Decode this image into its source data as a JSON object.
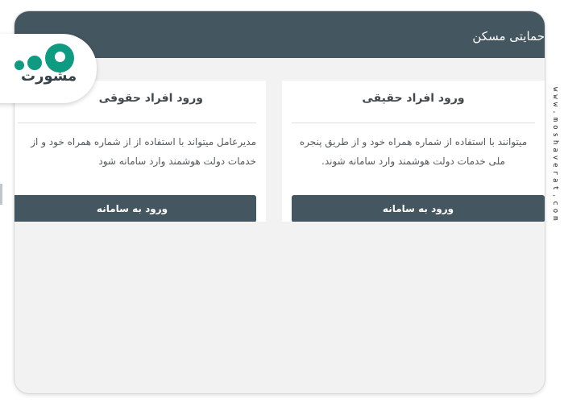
{
  "header": {
    "title": "حمایتی مسکن"
  },
  "cards": [
    {
      "title": "ورود افراد حقیقی",
      "description": "میتوانند با استفاده از شماره همراه خود و از طریق پنجره ملی خدمات دولت هوشمند وارد سامانه شوند.",
      "button_label": "ورود به سامانه"
    },
    {
      "title": "ورود افراد حقوقی",
      "description": "مدیرعامل میتواند با استفاده از از شماره همراه خود و از خدمات دولت هوشمند وارد سامانه شود",
      "button_label": "ورود به سامانه"
    }
  ],
  "logo": {
    "text": "مشورت"
  },
  "watermark": "www.moshaverat.com",
  "colors": {
    "header": "#44565f",
    "button": "#44565f",
    "brand": "#0f9a82",
    "panel": "#f2f2f3"
  }
}
